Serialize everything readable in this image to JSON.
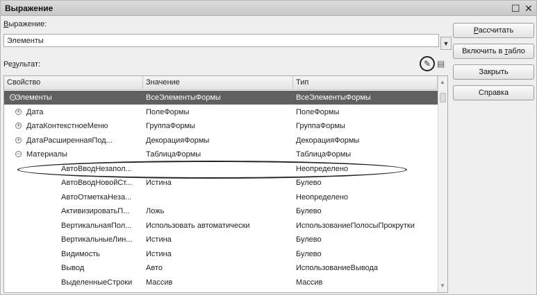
{
  "window": {
    "title": "Выражение",
    "maximize_icon": "maximize-icon",
    "close_icon": "close-icon"
  },
  "expression": {
    "label_accel": "В",
    "label_rest": "ыражение:",
    "value": "Элементы"
  },
  "result": {
    "label_pre": "Ре",
    "label_accel": "з",
    "label_post": "ультат:"
  },
  "buttons": {
    "calculate_accel": "Р",
    "calculate_rest": "ассчитать",
    "include_pre": "Включить в ",
    "include_accel": "т",
    "include_post": "абло",
    "close": "Закрыть",
    "help": "Справка"
  },
  "table": {
    "headers": [
      "Свойство",
      "Значение",
      "Тип"
    ],
    "rows": [
      {
        "prop": "Элементы",
        "value": "ВсеЭлементыФормы",
        "type": "ВсеЭлементыФормы",
        "level": 0,
        "expander": "minus",
        "selected": true
      },
      {
        "prop": "Дата",
        "value": "ПолеФормы",
        "type": "ПолеФормы",
        "level": 1,
        "expander": "plus"
      },
      {
        "prop": "ДатаКонтекстноеМеню",
        "value": "ГруппаФормы",
        "type": "ГруппаФормы",
        "level": 1,
        "expander": "plus"
      },
      {
        "prop": "ДатаРасширеннаяПод...",
        "value": "ДекорацияФормы",
        "type": "ДекорацияФормы",
        "level": 1,
        "expander": "plus"
      },
      {
        "prop": "Материалы",
        "value": "ТаблицаФормы",
        "type": "ТаблицаФормы",
        "level": 1,
        "expander": "minus"
      },
      {
        "prop": "АвтоВводНезапол...",
        "value": "",
        "type": "Неопределено",
        "level": 2
      },
      {
        "prop": "АвтоВводНовойСт...",
        "value": "Истина",
        "type": "Булево",
        "level": 2
      },
      {
        "prop": "АвтоОтметкаНеза...",
        "value": "",
        "type": "Неопределено",
        "level": 2
      },
      {
        "prop": "АктивизироватьП...",
        "value": "Ложь",
        "type": "Булево",
        "level": 2
      },
      {
        "prop": "ВертикальнаяПол...",
        "value": "Использовать автоматически",
        "type": "ИспользованиеПолосыПрокрутки",
        "level": 2
      },
      {
        "prop": "ВертикальныеЛин...",
        "value": "Истина",
        "type": "Булево",
        "level": 2
      },
      {
        "prop": "Видимость",
        "value": "Истина",
        "type": "Булево",
        "level": 2
      },
      {
        "prop": "Вывод",
        "value": "Авто",
        "type": "ИспользованиеВывода",
        "level": 2
      },
      {
        "prop": "ВыделенныеСтроки",
        "value": "Массив",
        "type": "Массив",
        "level": 2
      }
    ]
  },
  "icons": {
    "edit": "pencil-icon",
    "table_output": "table-output-icon",
    "dropdown": "chevron-down-icon"
  }
}
